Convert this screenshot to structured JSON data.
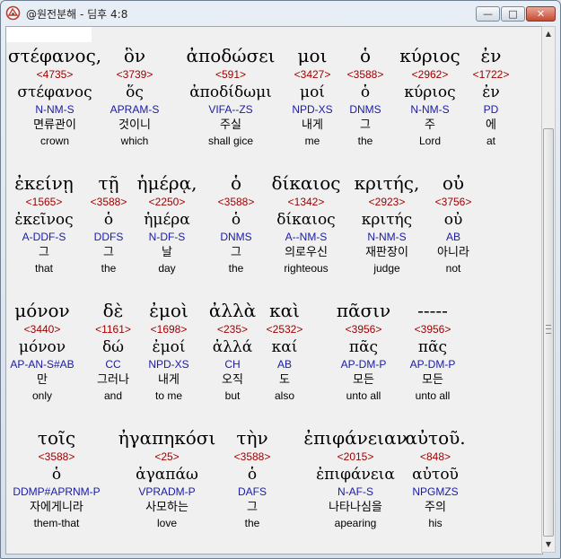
{
  "window": {
    "title": "@원전분해 - 딤후 4:8",
    "buttons": {
      "minimize": "—",
      "maximize": "□",
      "close": "✕"
    }
  },
  "scrollbar": {
    "up_arrow": "▲",
    "down_arrow": "▼"
  },
  "rows": [
    {
      "words": [
        {
          "greek": "στέφανος,",
          "strongs": "<4735>",
          "lemma": "στέφανος",
          "parsing": "N-NM-S",
          "korean": "면류관이",
          "english": "crown"
        },
        {
          "greek": "ὃν",
          "strongs": "<3739>",
          "lemma": "ὅς",
          "parsing": "APRAM-S",
          "korean": "것이니",
          "english": "which"
        },
        {
          "greek": "ἀποδώσει",
          "strongs": "<591>",
          "lemma": "ἀποδίδωμι",
          "parsing": "VIFA--ZS",
          "korean": "주실",
          "english": "shall gice"
        },
        {
          "greek": "μοι",
          "strongs": "<3427>",
          "lemma": "μοί",
          "parsing": "NPD-XS",
          "korean": "내게",
          "english": "me"
        },
        {
          "greek": "ὁ",
          "strongs": "<3588>",
          "lemma": "ὁ",
          "parsing": "DNMS",
          "korean": "그",
          "english": "the"
        },
        {
          "greek": "κύριος",
          "strongs": "<2962>",
          "lemma": "κύριος",
          "parsing": "N-NM-S",
          "korean": "주",
          "english": "Lord"
        },
        {
          "greek": "ἐν",
          "strongs": "<1722>",
          "lemma": "ἐν",
          "parsing": "PD",
          "korean": "에",
          "english": "at"
        }
      ]
    },
    {
      "words": [
        {
          "greek": "ἐκείνῃ",
          "strongs": "<1565>",
          "lemma": "ἐκεῖνος",
          "parsing": "A-DDF-S",
          "korean": "그",
          "english": "that"
        },
        {
          "greek": "τῇ",
          "strongs": "<3588>",
          "lemma": "ὁ",
          "parsing": "DDFS",
          "korean": "그",
          "english": "the"
        },
        {
          "greek": "ἡμέρᾳ,",
          "strongs": "<2250>",
          "lemma": "ἡμέρα",
          "parsing": "N-DF-S",
          "korean": "날",
          "english": "day"
        },
        {
          "greek": "ὁ",
          "strongs": "<3588>",
          "lemma": "ὁ",
          "parsing": "DNMS",
          "korean": "그",
          "english": "the"
        },
        {
          "greek": "δίκαιος",
          "strongs": "<1342>",
          "lemma": "δίκαιος",
          "parsing": "A--NM-S",
          "korean": "의로우신",
          "english": "righteous"
        },
        {
          "greek": "κριτής,",
          "strongs": "<2923>",
          "lemma": "κριτής",
          "parsing": "N-NM-S",
          "korean": "재판장이",
          "english": "judge"
        },
        {
          "greek": "οὐ",
          "strongs": "<3756>",
          "lemma": "οὐ",
          "parsing": "AB",
          "korean": "아니라",
          "english": "not"
        }
      ]
    },
    {
      "words": [
        {
          "greek": "μόνον",
          "strongs": "<3440>",
          "lemma": "μόνον",
          "parsing": "AP-AN-S#AB",
          "korean": "만",
          "english": "only"
        },
        {
          "greek": "δὲ",
          "strongs": "<1161>",
          "lemma": "δώ",
          "parsing": "CC",
          "korean": "그러나",
          "english": "and"
        },
        {
          "greek": "ἐμοὶ",
          "strongs": "<1698>",
          "lemma": "ἐμοί",
          "parsing": "NPD-XS",
          "korean": "내게",
          "english": "to me"
        },
        {
          "greek": "ἀλλὰ",
          "strongs": "<235>",
          "lemma": "ἀλλά",
          "parsing": "CH",
          "korean": "오직",
          "english": "but"
        },
        {
          "greek": "καὶ",
          "strongs": "<2532>",
          "lemma": "καί",
          "parsing": "AB",
          "korean": "도",
          "english": "also"
        },
        {
          "greek": "πᾶσιν",
          "strongs": "<3956>",
          "lemma": "πᾶς",
          "parsing": "AP-DM-P",
          "korean": "모든",
          "english": "unto all"
        },
        {
          "greek": "-----",
          "strongs": "<3956>",
          "lemma": "πᾶς",
          "parsing": "AP-DM-P",
          "korean": "모든",
          "english": "unto all"
        }
      ]
    },
    {
      "words": [
        {
          "greek": "τοῖς",
          "strongs": "<3588>",
          "lemma": "ὁ",
          "parsing": "DDMP#APRNM-P",
          "korean": "자에게니라",
          "english": "them-that"
        },
        {
          "greek": "ἠγαπηκόσι",
          "strongs": "<25>",
          "lemma": "ἀγαπάω",
          "parsing": "VPRADM-P",
          "korean": "사모하는",
          "english": "love"
        },
        {
          "greek": "τὴν",
          "strongs": "<3588>",
          "lemma": "ὁ",
          "parsing": "DAFS",
          "korean": "그",
          "english": "the"
        },
        {
          "greek": "ἐπιφάνειαν",
          "strongs": "<2015>",
          "lemma": "ἐπιφάνεια",
          "parsing": "N-AF-S",
          "korean": "나타나심을",
          "english": "apearing"
        },
        {
          "greek": "αὐτοῦ.",
          "strongs": "<848>",
          "lemma": "αὐτοῦ",
          "parsing": "NPGMZS",
          "korean": "주의",
          "english": "his"
        }
      ]
    }
  ]
}
